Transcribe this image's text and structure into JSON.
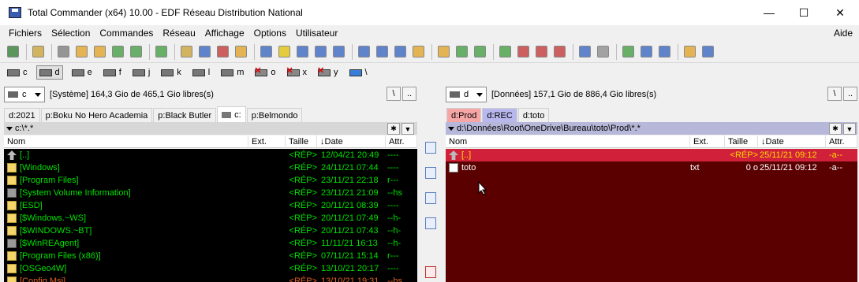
{
  "window": {
    "title": "Total Commander (x64) 10.00 - EDF Réseau Distribution National",
    "min": "—",
    "max": "☐",
    "close": "✕"
  },
  "menu": [
    "Fichiers",
    "Sélection",
    "Commandes",
    "Réseau",
    "Affichage",
    "Options",
    "Utilisateur"
  ],
  "menu_help": "Aide",
  "drives": [
    {
      "label": "c",
      "state": "normal"
    },
    {
      "label": "d",
      "state": "selected"
    },
    {
      "label": "e",
      "state": "normal"
    },
    {
      "label": "f",
      "state": "normal"
    },
    {
      "label": "j",
      "state": "normal"
    },
    {
      "label": "k",
      "state": "normal"
    },
    {
      "label": "l",
      "state": "normal"
    },
    {
      "label": "m",
      "state": "normal"
    },
    {
      "label": "o",
      "state": "missing"
    },
    {
      "label": "x",
      "state": "missing"
    },
    {
      "label": "y",
      "state": "missing"
    },
    {
      "label": "\\",
      "state": "network"
    }
  ],
  "left": {
    "drive": "c",
    "info": "[Système]  164,3 Gio de 465,1 Gio libres(s)",
    "root_btn": "\\",
    "up_btn": "..",
    "tabs": [
      "d:2021",
      "p:Boku No Hero Academia",
      "p:Black Butler",
      "c:",
      "p:Belmondo"
    ],
    "path": "c:\\*.*",
    "star": "✱",
    "dropdown": "▼",
    "columns": {
      "name": "Nom",
      "ext": "Ext.",
      "size": "Taille",
      "date": "↓Date",
      "attr": "Attr."
    },
    "rows": [
      {
        "icon": "up",
        "name": "[..]",
        "ext": "",
        "size": "<RÉP>",
        "date": "12/04/21 20:49",
        "attr": "----",
        "color": "#00e000"
      },
      {
        "icon": "folder",
        "name": "[Windows]",
        "ext": "",
        "size": "<RÉP>",
        "date": "24/11/21 07:44",
        "attr": "----",
        "color": "#00e000"
      },
      {
        "icon": "folder",
        "name": "[Program Files]",
        "ext": "",
        "size": "<RÉP>",
        "date": "23/11/21 22:18",
        "attr": "r---",
        "color": "#00e000"
      },
      {
        "icon": "sysfolder",
        "name": "[System Volume Information]",
        "ext": "",
        "size": "<RÉP>",
        "date": "23/11/21 21:09",
        "attr": "--hs",
        "color": "#00e000"
      },
      {
        "icon": "folder",
        "name": "[ESD]",
        "ext": "",
        "size": "<RÉP>",
        "date": "20/11/21 08:39",
        "attr": "----",
        "color": "#00e000"
      },
      {
        "icon": "folder",
        "name": "[$Windows.~WS]",
        "ext": "",
        "size": "<RÉP>",
        "date": "20/11/21 07:49",
        "attr": "--h-",
        "color": "#00e000"
      },
      {
        "icon": "folder",
        "name": "[$WINDOWS.~BT]",
        "ext": "",
        "size": "<RÉP>",
        "date": "20/11/21 07:43",
        "attr": "--h-",
        "color": "#00e000"
      },
      {
        "icon": "sysfolder",
        "name": "[$WinREAgent]",
        "ext": "",
        "size": "<RÉP>",
        "date": "11/11/21 16:13",
        "attr": "--h-",
        "color": "#00e000"
      },
      {
        "icon": "folder",
        "name": "[Program Files (x86)]",
        "ext": "",
        "size": "<RÉP>",
        "date": "07/11/21 15:14",
        "attr": "r---",
        "color": "#00e000"
      },
      {
        "icon": "folder",
        "name": "[OSGeo4W]",
        "ext": "",
        "size": "<RÉP>",
        "date": "13/10/21 20:17",
        "attr": "----",
        "color": "#00e000"
      },
      {
        "icon": "folder",
        "name": "[Config.Msi]",
        "ext": "",
        "size": "<RÉP>",
        "date": "13/10/21 19:31",
        "attr": "--hs",
        "color": "#e06020"
      }
    ]
  },
  "right": {
    "drive": "d",
    "info": "[Données]  157,1 Gio de 886,4 Gio libres(s)",
    "root_btn": "\\",
    "up_btn": "..",
    "tabs": [
      "d:Prod",
      "d:REC",
      "d:toto"
    ],
    "path": "d:\\Données\\Root\\OneDrive\\Bureau\\toto\\Prod\\*.*",
    "star": "✱",
    "dropdown": "▼",
    "columns": {
      "name": "Nom",
      "ext": "Ext.",
      "size": "Taille",
      "date": "↓Date",
      "attr": "Attr."
    },
    "rows": [
      {
        "icon": "up",
        "name": "[..]",
        "ext": "",
        "size": "<RÉP>",
        "date": "25/11/21 09:12",
        "attr": "-a--",
        "color": "#ffd800"
      },
      {
        "icon": "file",
        "name": "toto",
        "ext": "txt",
        "size": "0 o",
        "date": "25/11/21 09:12",
        "attr": "-a--",
        "color": "#ffffff"
      }
    ]
  },
  "colors": {
    "left_bg": "#000000",
    "right_bg": "#5a0000",
    "right_cursor": "#d0203a",
    "tab_prod": "#f7a6a6",
    "tab_rec": "#b8b8ee",
    "path_active": "#b7b7d9"
  }
}
